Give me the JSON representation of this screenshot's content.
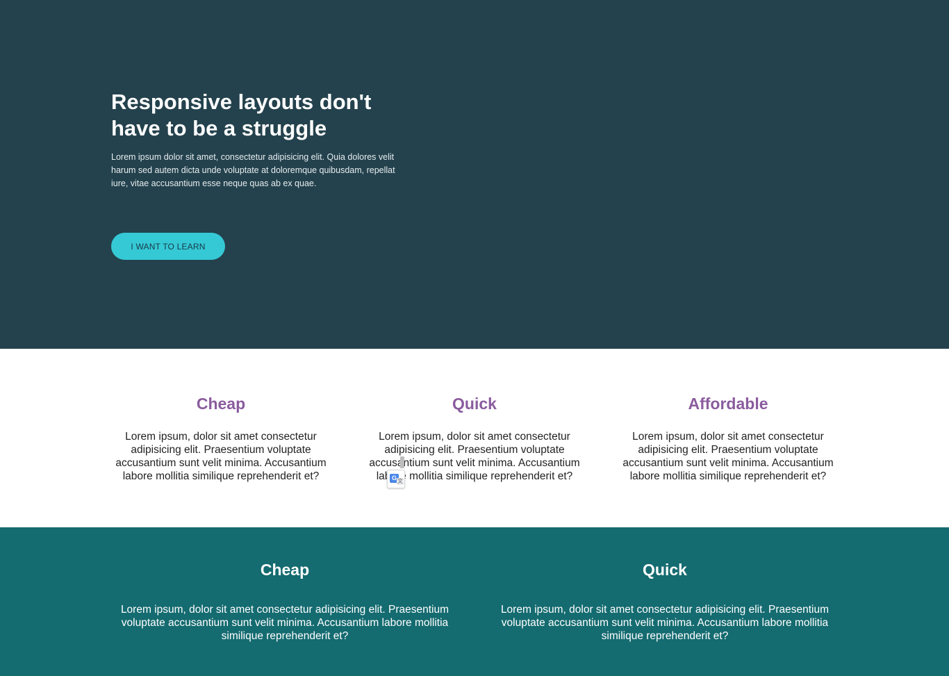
{
  "hero": {
    "title": "Responsive layouts don't have to be a struggle",
    "text": "Lorem ipsum dolor sit amet, consectetur adipisicing elit. Quia dolores velit harum sed autem dicta unde voluptate at doloremque quibusdam, repellat iure, vitae accusantium esse neque quas ab ex quae.",
    "button_label": "I WANT TO LEARN"
  },
  "features": [
    {
      "title": "Cheap",
      "text": "Lorem ipsum, dolor sit amet consectetur adipisicing elit. Praesentium voluptate accusantium sunt velit minima. Accusantium labore mollitia similique reprehenderit et?"
    },
    {
      "title": "Quick",
      "text": "Lorem ipsum, dolor sit amet consectetur adipisicing elit. Praesentium voluptate accusantium sunt velit minima. Accusantium labore mollitia similique reprehenderit et?"
    },
    {
      "title": "Affordable",
      "text": "Lorem ipsum, dolor sit amet consectetur adipisicing elit. Praesentium voluptate accusantium sunt velit minima. Accusantium labore mollitia similique reprehenderit et?"
    }
  ],
  "bottom": [
    {
      "title": "Cheap",
      "text": "Lorem ipsum, dolor sit amet consectetur adipisicing elit. Praesentium voluptate accusantium sunt velit minima. Accusantium labore mollitia similique reprehenderit et?"
    },
    {
      "title": "Quick",
      "text": "Lorem ipsum, dolor sit amet consectetur adipisicing elit. Praesentium voluptate accusantium sunt velit minima. Accusantium labore mollitia similique reprehenderit et?"
    }
  ],
  "translate_icon": {
    "name": "google-translate-icon",
    "glyph_g": "G",
    "glyph_x": "文"
  },
  "colors": {
    "hero_bg": "#24424d",
    "accent": "#35c9d6",
    "feature_title": "#8a5c9e",
    "bottom_bg": "#146b70"
  }
}
